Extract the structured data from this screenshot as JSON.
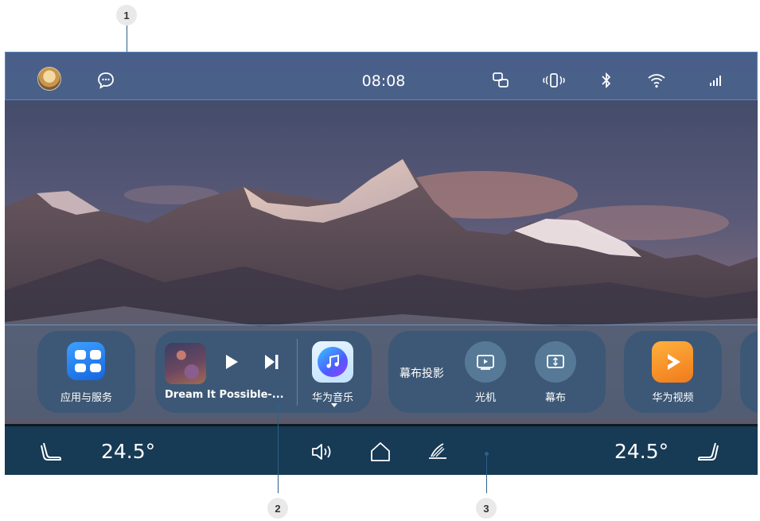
{
  "callouts": {
    "c1": "1",
    "c2": "2",
    "c3": "3"
  },
  "status_bar": {
    "time": "08:08",
    "icons": [
      "avatar",
      "message-icon",
      "screen-mirror-icon",
      "vibrate-icon",
      "bluetooth-icon",
      "wifi-icon",
      "signal-icon"
    ]
  },
  "dock": {
    "apps_services": {
      "label": "应用与服务",
      "icon": "apps-grid-icon"
    },
    "music_card": {
      "song_title": "Dream It Possible-...",
      "app_label": "华为音乐",
      "controls": [
        "play-icon",
        "next-track-icon"
      ],
      "app_icon": "music-note-icon"
    },
    "projection_card": {
      "title": "幕布投影",
      "projector_label": "光机",
      "screen_label": "幕布"
    },
    "video_card": {
      "label": "华为视频",
      "icon": "video-play-icon"
    }
  },
  "bottom_bar": {
    "left_temp": "24.5°",
    "right_temp": "24.5°",
    "icons": [
      "left-seat-icon",
      "volume-icon",
      "home-icon",
      "wiper-icon",
      "right-seat-icon"
    ]
  },
  "colors": {
    "status_bar_bg": "#4a628c",
    "dock_card_bg": "#3a5876",
    "bottom_bar_bg": "#173a55",
    "callout_line": "#2d5f8a"
  }
}
